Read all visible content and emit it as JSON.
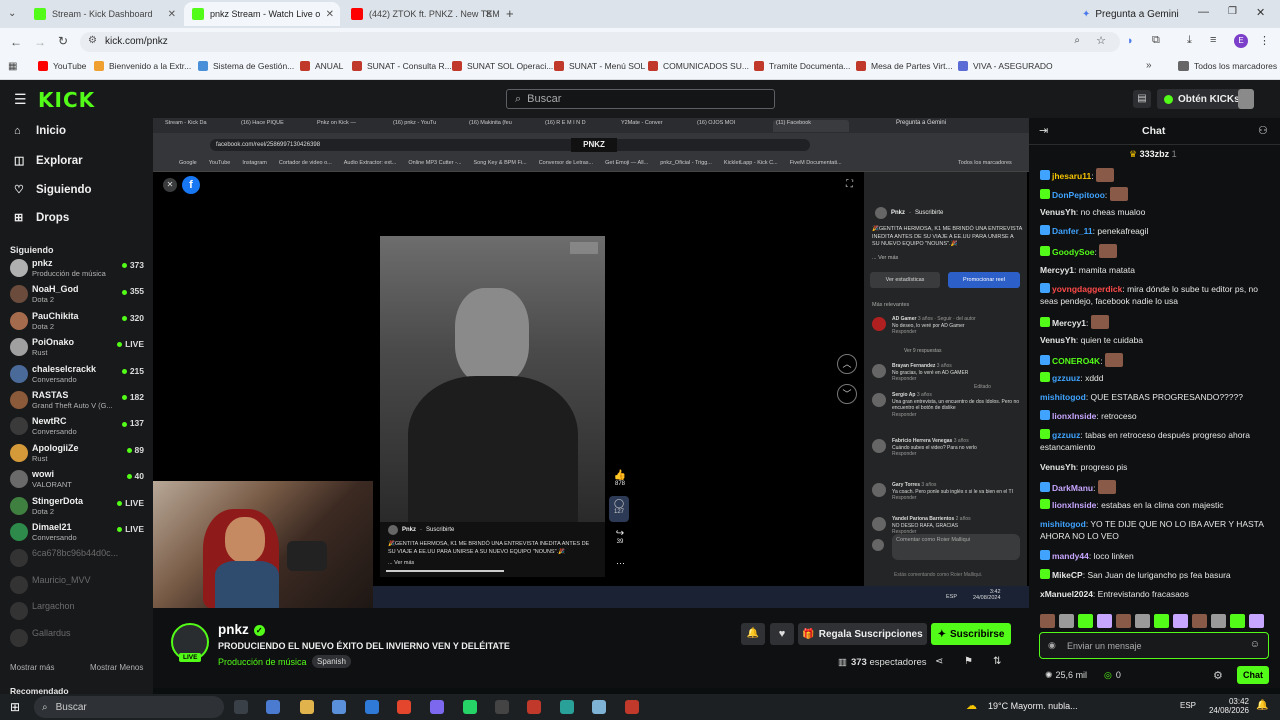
{
  "browser": {
    "tabs": [
      {
        "title": "Stream - Kick Dashboard",
        "color": "#53fc18",
        "active": false
      },
      {
        "title": "pnkz Stream - Watch Live o",
        "color": "#53fc18",
        "active": true
      },
      {
        "title": "(442) ZTOK ft. PNKZ . New TEM",
        "color": "#ff0000",
        "active": false
      }
    ],
    "gemini_button": "Pregunta a Gemini",
    "url": "kick.com/pnkz",
    "bookmarks": [
      "YouTube",
      "Bienvenido a la Extr...",
      "Sistema de Gestión...",
      "ANUAL",
      "SUNAT - Consulta R...",
      "SUNAT SOL Operaci...",
      "SUNAT - Menú SOL",
      "COMUNICADOS SU...",
      "Tramite Documenta...",
      "Mesa de Partes Virt...",
      "VIVA - ASEGURADO"
    ],
    "all_bookmarks": "Todos los marcadores"
  },
  "kick": {
    "logo": "KICK",
    "search_placeholder": "Buscar",
    "get_kicks": "Obtén KICKs",
    "nav": [
      {
        "label": "Inicio",
        "icon": "home-icon"
      },
      {
        "label": "Explorar",
        "icon": "compass-icon"
      },
      {
        "label": "Siguiendo",
        "icon": "heart-icon"
      },
      {
        "label": "Drops",
        "icon": "gift-icon"
      }
    ],
    "following_title": "Siguiendo",
    "following": [
      {
        "name": "pnkz",
        "category": "Producción de música",
        "viewers": "373",
        "live": true
      },
      {
        "name": "NoaH_God",
        "category": "Dota 2",
        "viewers": "355",
        "live": true
      },
      {
        "name": "PauChikita",
        "category": "Dota 2",
        "viewers": "320",
        "live": true
      },
      {
        "name": "PoiOnako",
        "category": "Rust",
        "viewers": "LIVE",
        "live": true
      },
      {
        "name": "chaleselcrackk",
        "category": "Conversando",
        "viewers": "215",
        "live": true
      },
      {
        "name": "RASTAS",
        "category": "Grand Theft Auto V (G...",
        "viewers": "182",
        "live": true
      },
      {
        "name": "NewtRC",
        "category": "Conversando",
        "viewers": "137",
        "live": true
      },
      {
        "name": "ApologiiZe",
        "category": "Rust",
        "viewers": "89",
        "live": true
      },
      {
        "name": "wowi",
        "category": "VALORANT",
        "viewers": "40",
        "live": true
      },
      {
        "name": "StingerDota",
        "category": "Dota 2",
        "viewers": "LIVE",
        "live": true
      },
      {
        "name": "Dimael21",
        "category": "Conversando",
        "viewers": "LIVE",
        "live": true
      },
      {
        "name": "6ca678bc96b44d0c...",
        "category": "",
        "viewers": "",
        "live": false
      },
      {
        "name": "Mauricio_MVV",
        "category": "",
        "viewers": "",
        "live": false
      },
      {
        "name": "Largachon",
        "category": "",
        "viewers": "",
        "live": false
      },
      {
        "name": "Gallardus",
        "category": "",
        "viewers": "",
        "live": false
      }
    ],
    "show_more": "Mostrar más",
    "show_less": "Mostrar Menos",
    "recommended": "Recomendado"
  },
  "video": {
    "inner_url": "facebook.com/reel/2586997130426398",
    "inner_tabs": [
      "Stream - Kick Da",
      "(16) Hace PIQUE",
      "Pnkz on Kick — ",
      "(16) pnkz - YouTu",
      "(16) Makinita (feu",
      "(16) R E M I N D",
      "Y2Mate - Conver",
      "(16) OJOS MOI",
      "(11) Facebook"
    ],
    "inner_gemini": "Pregunta a Gemini",
    "inner_bookmarks": [
      "Google",
      "YouTube",
      "Instagram",
      "Cortador de video o...",
      "Audio Extractor: ext...",
      "Online MP3 Cutter -...",
      "Song Key & BPM Fi...",
      "Conversor de Letras...",
      "Get Emoji — All...",
      "pnkz_Oficial - Trigg...",
      "KickletLapp - Kick C...",
      "FiveM Documentati..."
    ],
    "inner_all_bookmarks": "Todos los marcadores",
    "reel_watermark": "PNKZ",
    "reel_author": "Pnkz",
    "reel_subscribe": "Suscribirte",
    "reel_caption": "🎉GENTITA HERMOSA, K1 ME BRINDÓ UNA ENTREVISTA INEDITA ANTES DE SU VIAJE A EE.UU PARA UNIRSE A SU NUEVO EQUIPO \"NOUNS\".🎉",
    "reel_more": "... Ver más",
    "likes": "878",
    "comments": "127",
    "shares": "39",
    "panel_stats": "Ver estadísticas",
    "panel_promote": "Promocionar reel",
    "panel_sort": "Más relevantes",
    "fb_comments": [
      {
        "user": "AD Gamer",
        "meta": "3 años · Seguir · del autor",
        "text": "No deseo, lo veré por AD Gamer"
      },
      {
        "user": "Brayan Fernandez",
        "meta": "3 años",
        "text": "No gracias, lo veré en AD GAMER"
      },
      {
        "user": "Sergio Ap",
        "meta": "3 años",
        "text": "Una gran entrevista, un encuentro de dos ídolos. Pero no encuentro el botón de dislike"
      },
      {
        "user": "Fabricio Herrera Venegas",
        "meta": "3 años",
        "text": "Cuándo subes el video? Para no verlo"
      },
      {
        "user": "Gary Torres",
        "meta": "3 años",
        "text": "Ya coach. Pero ponle sub inglés x si le va bien en el TI"
      },
      {
        "user": "Yandel Pariona Barrientos",
        "meta": "2 años",
        "text": "NO DESEO RAFA, GRACIAS"
      }
    ],
    "see_replies": "Ver 9 respuestas",
    "reply": "Responder",
    "edited": "Editado",
    "comment_placeholder": "Comentar como Roier Malliqui",
    "commenting_as": "Estás comentando como Roier Malliqui.",
    "inner_time": "3:42",
    "inner_date": "24/08/2024",
    "inner_lang": "ESP"
  },
  "stream": {
    "channel": "pnkz",
    "title": "PRODUCIENDO EL NUEVO ÉXITO DEL INVIERNO VEN Y DELÉITATE",
    "category": "Producción de música",
    "language": "Spanish",
    "live_badge": "LIVE",
    "gift_subs": "Regala Suscripciones",
    "subscribe": "Suscribirse",
    "viewers": "373",
    "viewers_label": "espectadores"
  },
  "chat": {
    "title": "Chat",
    "pinned_user": "333zbz",
    "pinned_count": "1",
    "messages": [
      {
        "user": "jhesaru11",
        "color": "#f5c400",
        "text": ""
      },
      {
        "user": "DonPepitooo",
        "color": "#3fa3ff",
        "text": ""
      },
      {
        "user": "VenusYh",
        "color": "#e6e6e6",
        "text": "no cheas mualoo"
      },
      {
        "user": "Danfer_11",
        "color": "#3fa3ff",
        "text": "penekafreagil"
      },
      {
        "user": "GoodySoe",
        "color": "#53fc18",
        "text": ""
      },
      {
        "user": "Mercyy1",
        "color": "#e6e6e6",
        "text": "mamita matata"
      },
      {
        "user": "yovngdaggerdick",
        "color": "#ff4a4a",
        "text": "mira dónde lo sube tu editor ps, no seas pendejo, facebook nadie lo usa"
      },
      {
        "user": "Mercyy1",
        "color": "#e6e6e6",
        "text": ""
      },
      {
        "user": "VenusYh",
        "color": "#e6e6e6",
        "text": "quien te cuidaba"
      },
      {
        "user": "CONERO4K",
        "color": "#53fc18",
        "text": ""
      },
      {
        "user": "gzzuuz",
        "color": "#3fa3ff",
        "text": "xddd"
      },
      {
        "user": "mishitogod",
        "color": "#3fa3ff",
        "text": "QUE ESTABAS PROGRESANDO?????"
      },
      {
        "user": "lionxInside",
        "color": "#c7a6ff",
        "text": "retroceso"
      },
      {
        "user": "gzzuuz",
        "color": "#3fa3ff",
        "text": "tabas en retroceso después progreso ahora estancamiento"
      },
      {
        "user": "VenusYh",
        "color": "#e6e6e6",
        "text": "progreso pis"
      },
      {
        "user": "DarkManu",
        "color": "#c7a6ff",
        "text": ""
      },
      {
        "user": "lionxInside",
        "color": "#c7a6ff",
        "text": "estabas en la clima con majestic"
      },
      {
        "user": "mishitogod",
        "color": "#3fa3ff",
        "text": "YO TE DIJE QUE NO LO IBA AVER Y HASTA AHORA NO LO VEO"
      },
      {
        "user": "mandy44",
        "color": "#c7a6ff",
        "text": "loco linken"
      },
      {
        "user": "MikeCP",
        "color": "#e6e6e6",
        "text": "San Juan de lurigancho ps fea basura"
      },
      {
        "user": "xManuel2024",
        "color": "#e6e6e6",
        "text": "Entrevistando fracasaos"
      }
    ],
    "input_placeholder": "Enviar un mensaje",
    "kicks_balance": "25,6 mil",
    "points": "0",
    "send_button": "Chat"
  },
  "taskbar": {
    "search": "Buscar",
    "weather_temp": "19°C",
    "weather_text": "Mayorm. nubla...",
    "lang": "ESP",
    "time": "03:42",
    "date": "24/08/2026"
  }
}
